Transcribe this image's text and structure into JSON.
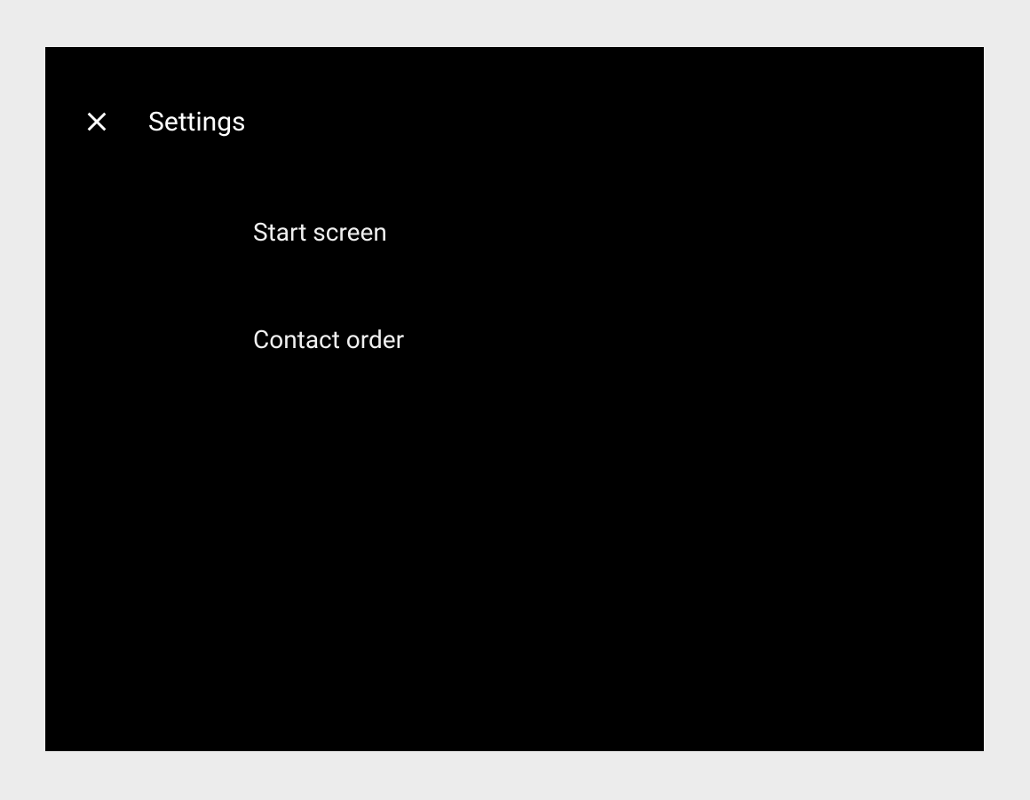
{
  "header": {
    "title": "Settings"
  },
  "settings": {
    "items": [
      {
        "label": "Start screen"
      },
      {
        "label": "Contact order"
      }
    ]
  }
}
